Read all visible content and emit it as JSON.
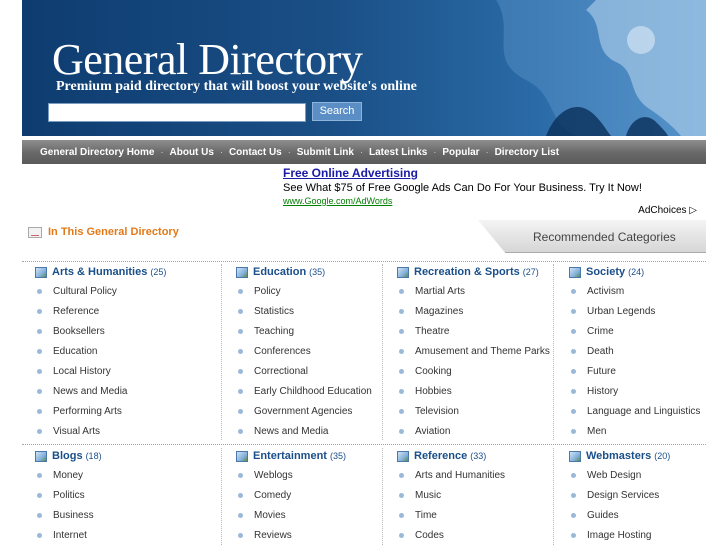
{
  "header": {
    "title": "General Directory",
    "tagline": "Premium paid directory that will boost your website's online",
    "search_placeholder": "",
    "search_button": "Search"
  },
  "nav": [
    "General Directory Home",
    "About Us",
    "Contact Us",
    "Submit Link",
    "Latest Links",
    "Popular",
    "Directory List"
  ],
  "nav_separator": "·",
  "ad": {
    "title": "Free Online Advertising",
    "description": "See What $75 of Free Google Ads Can Do For Your Business. Try It Now!",
    "url": "www.Google.com/AdWords",
    "adchoices": "AdChoices ▷"
  },
  "in_directory": "In This General Directory",
  "recommended": "Recommended Categories",
  "categories": [
    {
      "name": "Arts & Humanities",
      "count": "(25)",
      "items": [
        "Cultural Policy",
        "Reference",
        "Booksellers",
        "Education",
        "Local History",
        "News and Media",
        "Performing Arts",
        "Visual Arts"
      ]
    },
    {
      "name": "Education",
      "count": "(35)",
      "items": [
        "Policy",
        "Statistics",
        "Teaching",
        "Conferences",
        "Correctional",
        "Early Childhood Education",
        "Government Agencies",
        "News and Media"
      ]
    },
    {
      "name": "Recreation & Sports",
      "count": "(27)",
      "items": [
        "Martial Arts",
        "Magazines",
        "Theatre",
        "Amusement and Theme Parks",
        "Cooking",
        "Hobbies",
        "Television",
        "Aviation"
      ]
    },
    {
      "name": "Society",
      "count": "(24)",
      "items": [
        "Activism",
        "Urban Legends",
        "Crime",
        "Death",
        "Future",
        "History",
        "Language and Linguistics",
        "Men"
      ]
    },
    {
      "name": "Blogs",
      "count": "(18)",
      "items": [
        "Money",
        "Politics",
        "Business",
        "Internet"
      ]
    },
    {
      "name": "Entertainment",
      "count": "(35)",
      "items": [
        "Weblogs",
        "Comedy",
        "Movies",
        "Reviews"
      ]
    },
    {
      "name": "Reference",
      "count": "(33)",
      "items": [
        "Arts and Humanities",
        "Music",
        "Time",
        "Codes"
      ]
    },
    {
      "name": "Webmasters",
      "count": "(20)",
      "items": [
        "Web Design",
        "Design Services",
        "Guides",
        "Image Hosting"
      ]
    }
  ],
  "colors": {
    "header_dark": "#0e3c70",
    "link_blue": "#1a4f8a",
    "accent_orange": "#e27a1a",
    "ad_green": "#008000"
  }
}
